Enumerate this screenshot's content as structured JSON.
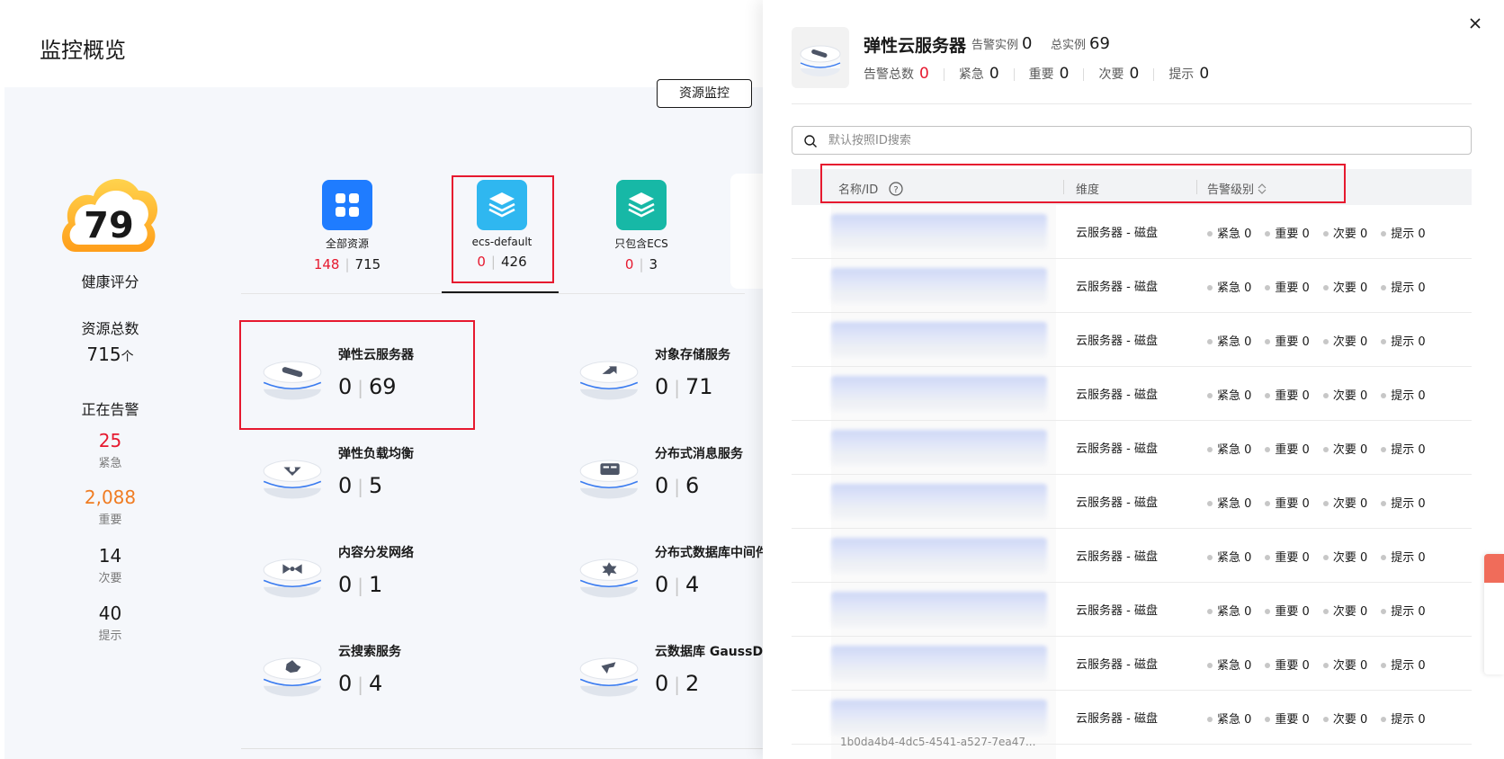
{
  "page": {
    "title": "监控概览",
    "tab": "资源监控"
  },
  "health": {
    "score": "79",
    "label": "健康评分"
  },
  "summary": {
    "total_title": "资源总数",
    "total_value": "715",
    "total_unit": "个",
    "alarm_title": "正在告警",
    "alarms": [
      {
        "value": "25",
        "label": "紧急",
        "color": "#e6192f"
      },
      {
        "value": "2,088",
        "label": "重要",
        "color": "#f07c22"
      },
      {
        "value": "14",
        "label": "次要",
        "color": "#191919"
      },
      {
        "value": "40",
        "label": "提示",
        "color": "#191919"
      }
    ]
  },
  "categories": [
    {
      "label": "全部资源",
      "alarm": "148",
      "total": "715",
      "icon": "grid-icon",
      "color": "#1f7cff"
    },
    {
      "label": "ecs-default",
      "alarm": "0",
      "total": "426",
      "icon": "layers-icon",
      "color": "#2fb7f0"
    },
    {
      "label": "只包含ECS",
      "alarm": "0",
      "total": "3",
      "icon": "layers-icon",
      "color": "#17b8a6"
    }
  ],
  "services": [
    {
      "name": "弹性云服务器",
      "alarm": "0",
      "total": "69",
      "icon": "ecs-icon"
    },
    {
      "name": "对象存储服务",
      "alarm": "0",
      "total": "71",
      "icon": "obs-icon"
    },
    {
      "name": "弹性负载均衡",
      "alarm": "0",
      "total": "5",
      "icon": "elb-icon"
    },
    {
      "name": "分布式消息服务",
      "alarm": "0",
      "total": "6",
      "icon": "dms-icon"
    },
    {
      "name": "内容分发网络",
      "alarm": "0",
      "total": "1",
      "icon": "cdn-icon"
    },
    {
      "name": "分布式数据库中间件",
      "alarm": "0",
      "total": "4",
      "icon": "ddm-icon"
    },
    {
      "name": "云搜索服务",
      "alarm": "0",
      "total": "4",
      "icon": "css-icon"
    },
    {
      "name": "云数据库 GaussDB(f",
      "alarm": "0",
      "total": "2",
      "icon": "gaussdb-icon"
    }
  ],
  "drawer": {
    "title": "弹性云服务器",
    "alarm_instances_label": "告警实例",
    "alarm_instances": "0",
    "total_instances_label": "总实例",
    "total_instances": "69",
    "stats": [
      {
        "label": "告警总数",
        "value": "0",
        "color": "#e6192f"
      },
      {
        "label": "紧急",
        "value": "0",
        "color": "#191919"
      },
      {
        "label": "重要",
        "value": "0",
        "color": "#191919"
      },
      {
        "label": "次要",
        "value": "0",
        "color": "#191919"
      },
      {
        "label": "提示",
        "value": "0",
        "color": "#191919"
      }
    ],
    "search_placeholder": "默认按照ID搜索",
    "columns": [
      "名称/ID",
      "维度",
      "告警级别"
    ],
    "row_dimension": "云服务器 - 磁盘",
    "row_levels": [
      "紧急 0",
      "重要 0",
      "次要 0",
      "提示 0"
    ],
    "last_row_id": "1b0da4b4-4dc5-4541-a527-7ea47..."
  }
}
